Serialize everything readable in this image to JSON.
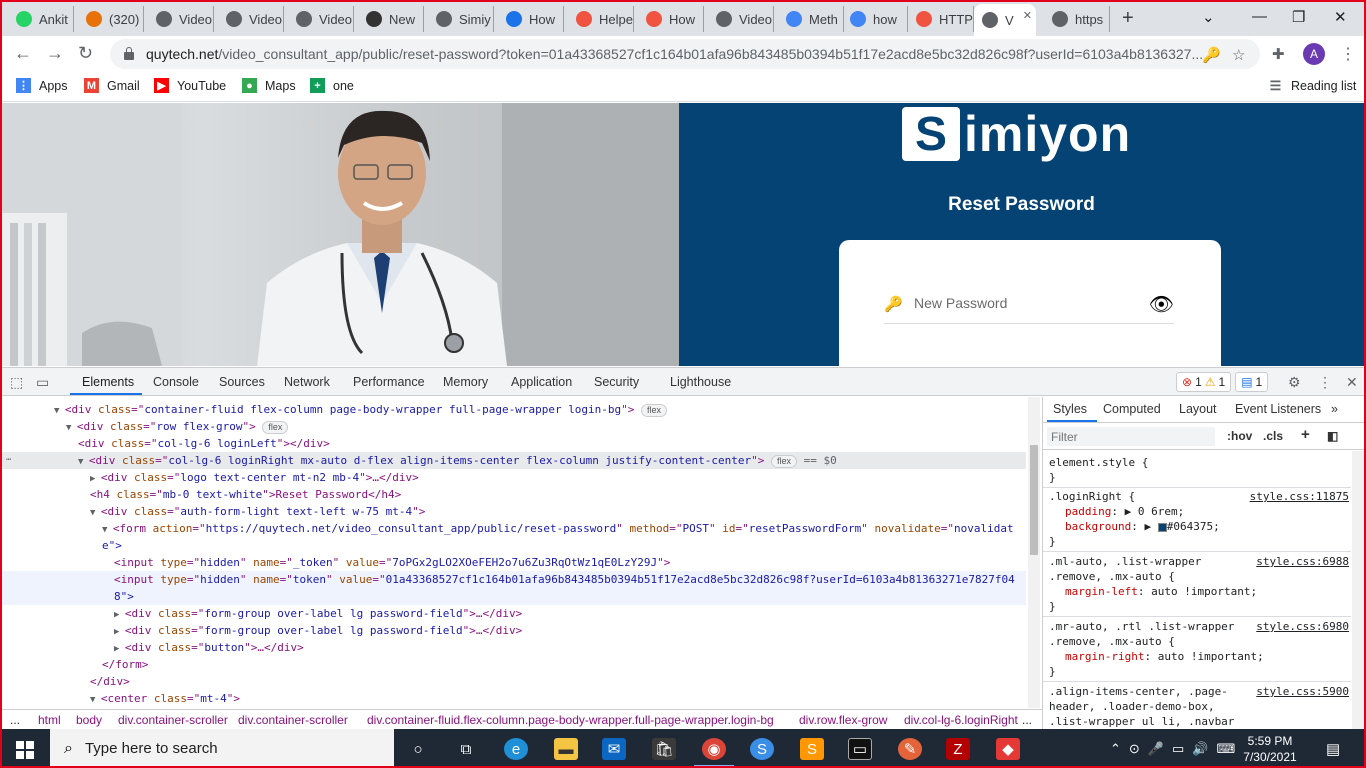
{
  "tabs": [
    {
      "title": "Ankit",
      "icon": "whatsapp-icon",
      "color": "#25d366"
    },
    {
      "title": "(320)",
      "icon": "check-icon",
      "color": "#e8710a"
    },
    {
      "title": "Video",
      "icon": "globe-icon",
      "color": "#5f6368"
    },
    {
      "title": "Video",
      "icon": "globe-icon",
      "color": "#5f6368"
    },
    {
      "title": "Video",
      "icon": "globe-icon",
      "color": "#5f6368"
    },
    {
      "title": "New",
      "icon": "github-icon",
      "color": "#333333"
    },
    {
      "title": "Simiy",
      "icon": "globe-icon",
      "color": "#5f6368"
    },
    {
      "title": "How",
      "icon": "number-five-icon",
      "color": "#1a73e8"
    },
    {
      "title": "Helpe",
      "icon": "laravel-icon",
      "color": "#f05340"
    },
    {
      "title": "How",
      "icon": "laravel-icon",
      "color": "#f05340"
    },
    {
      "title": "Video",
      "icon": "globe-icon",
      "color": "#5f6368"
    },
    {
      "title": "Meth",
      "icon": "google-icon",
      "color": "#4285f4"
    },
    {
      "title": "how",
      "icon": "google-icon",
      "color": "#4285f4"
    },
    {
      "title": "HTTP",
      "icon": "laravel-icon",
      "color": "#f05340"
    },
    {
      "title": "V",
      "icon": "globe-icon",
      "color": "#5f6368"
    },
    {
      "title": "https",
      "icon": "globe-icon",
      "color": "#5f6368"
    }
  ],
  "toolbar": {
    "url_host": "quytech.net",
    "url_rest": "/video_consultant_app/public/reset-password?token=01a43368527cf1c164b01afa96b843485b0394b51f17e2acd8e5bc32d826c98f?userId=6103a4b8136327...",
    "avatar_letter": "A"
  },
  "bookmarks": [
    {
      "label": "Apps",
      "icon": "apps-grid-icon",
      "color": "#4285f4"
    },
    {
      "label": "Gmail",
      "icon": "gmail-icon",
      "color": "#ea4335"
    },
    {
      "label": "YouTube",
      "icon": "youtube-icon",
      "color": "#ff0000"
    },
    {
      "label": "Maps",
      "icon": "maps-pin-icon",
      "color": "#34a853"
    },
    {
      "label": "one",
      "icon": "plus-icon",
      "color": "#0f9d58"
    }
  ],
  "reading_list": "Reading list",
  "page": {
    "logo_letter": "S",
    "logo_text": "imiyon",
    "title": "Reset Password",
    "password_placeholder": "New Password",
    "brand_color": "#064375"
  },
  "devtools": {
    "tabs": [
      "Elements",
      "Console",
      "Sources",
      "Network",
      "Performance",
      "Memory",
      "Application",
      "Security",
      "Lighthouse"
    ],
    "errors": "1",
    "warnings": "1",
    "messages": "1",
    "styles_tabs": [
      "Styles",
      "Computed",
      "Layout",
      "Event Listeners"
    ],
    "filter_placeholder": "Filter",
    "hov": ":hov",
    "cls": ".cls",
    "breadcrumbs": [
      "...",
      "html",
      "body",
      "div.container-scroller",
      "div.container-scroller",
      "div.container-fluid.flex-column.page-body-wrapper.full-page-wrapper.login-bg",
      "div.row.flex-grow",
      "div.col-lg-6.loginRight",
      "..."
    ],
    "dom_lines": [
      {
        "pre": "▼",
        "tag": "div",
        "attrs": [
          [
            "class",
            "container-fluid flex-column page-body-wrapper full-page-wrapper login-bg"
          ]
        ],
        "tail": ">",
        "pill": "flex"
      },
      {
        "pre": "▼",
        "tag": "div",
        "attrs": [
          [
            "class",
            "row flex-grow"
          ]
        ],
        "tail": ">",
        "pill": "flex"
      },
      {
        "pre": "",
        "tag": "div",
        "attrs": [
          [
            "class",
            "col-lg-6 loginLeft"
          ]
        ],
        "tail": "></div>",
        "pill": ""
      },
      {
        "pre": "▼",
        "tag": "div",
        "attrs": [
          [
            "class",
            "col-lg-6 loginRight mx-auto d-flex align-items-center flex-column justify-content-center"
          ]
        ],
        "tail": ">",
        "pill": "flex",
        "suffix": "== $0"
      },
      {
        "pre": "▶",
        "tag": "div",
        "attrs": [
          [
            "class",
            "logo text-center mt-n2 mb-4"
          ]
        ],
        "tail": ">…</div>",
        "pill": ""
      },
      {
        "pre": "",
        "tag": "h4",
        "attrs": [
          [
            "class",
            "mb-0 text-white"
          ]
        ],
        "tail": ">Reset Password</h4>",
        "pill": ""
      },
      {
        "pre": "▼",
        "tag": "div",
        "attrs": [
          [
            "class",
            "auth-form-light text-left w-75 mt-4"
          ]
        ],
        "tail": ">",
        "pill": ""
      },
      {
        "pre": "▼",
        "tag": "form",
        "attrs": [
          [
            "action",
            "https://quytech.net/video_consultant_app/public/reset-password"
          ],
          [
            "method",
            "POST"
          ],
          [
            "id",
            "resetPasswordForm"
          ],
          [
            "novalidate",
            "novalidat"
          ]
        ],
        "tail": "",
        "pill": ""
      },
      {
        "pre": "",
        "tag": "",
        "attrs": [],
        "tail": "e\">",
        "pill": ""
      },
      {
        "pre": "",
        "tag": "input",
        "attrs": [
          [
            "type",
            "hidden"
          ],
          [
            "name",
            "_token"
          ],
          [
            "value",
            "7oPGx2gLO2XOeFEH2o7u6Zu3RqOtWz1qE0LzY29J"
          ]
        ],
        "tail": ">",
        "pill": ""
      },
      {
        "pre": "",
        "tag": "input",
        "attrs": [
          [
            "type",
            "hidden"
          ],
          [
            "name",
            "token"
          ],
          [
            "value",
            "01a43368527cf1c164b01afa96b843485b0394b51f17e2acd8e5bc32d826c98f?userId=6103a4b81363271e7827f04"
          ]
        ],
        "tail": "",
        "pill": ""
      },
      {
        "pre": "",
        "tag": "",
        "attrs": [],
        "tail": "8\">",
        "pill": ""
      },
      {
        "pre": "▶",
        "tag": "div",
        "attrs": [
          [
            "class",
            "form-group over-label lg password-field"
          ]
        ],
        "tail": ">…</div>",
        "pill": ""
      },
      {
        "pre": "▶",
        "tag": "div",
        "attrs": [
          [
            "class",
            "form-group over-label lg password-field"
          ]
        ],
        "tail": ">…</div>",
        "pill": ""
      },
      {
        "pre": "▶",
        "tag": "div",
        "attrs": [
          [
            "class",
            "button"
          ]
        ],
        "tail": ">…</div>",
        "pill": ""
      },
      {
        "pre": "",
        "tag": "",
        "attrs": [],
        "tail": "</form>",
        "pill": ""
      },
      {
        "pre": "",
        "tag": "",
        "attrs": [],
        "tail": "</div>",
        "pill": ""
      },
      {
        "pre": "▼",
        "tag": "center",
        "attrs": [
          [
            "class",
            "mt-4"
          ]
        ],
        "tail": ">",
        "pill": ""
      }
    ],
    "style_rules": [
      {
        "selector": "element.style {",
        "source": "",
        "decls": [],
        "close": "}"
      },
      {
        "selector": ".loginRight {",
        "source": "style.css:11875",
        "decls": [
          [
            "padding",
            "▶ 0 6rem;"
          ],
          [
            "background",
            "▶ #064375;"
          ]
        ],
        "close": "}"
      },
      {
        "selector": ".ml-auto, .list-wrapper .remove, .mx-auto {",
        "source": "style.css:6988",
        "decls": [
          [
            "margin-left",
            "auto !important;"
          ]
        ],
        "close": "}"
      },
      {
        "selector": ".mr-auto, .rtl .list-wrapper .remove, .mx-auto {",
        "source": "style.css:6980",
        "decls": [
          [
            "margin-right",
            "auto !important;"
          ]
        ],
        "close": "}"
      },
      {
        "selector": ".align-items-center, .page-header, .loader-demo-box, .list-wrapper ul li, .navbar .navbar-menu-wrapper .navbar-nav",
        "source": "style.css:5900",
        "decls": [],
        "close": ""
      }
    ]
  },
  "taskbar": {
    "search_placeholder": "Type here to search",
    "time": "5:59 PM",
    "date": "7/30/2021"
  }
}
